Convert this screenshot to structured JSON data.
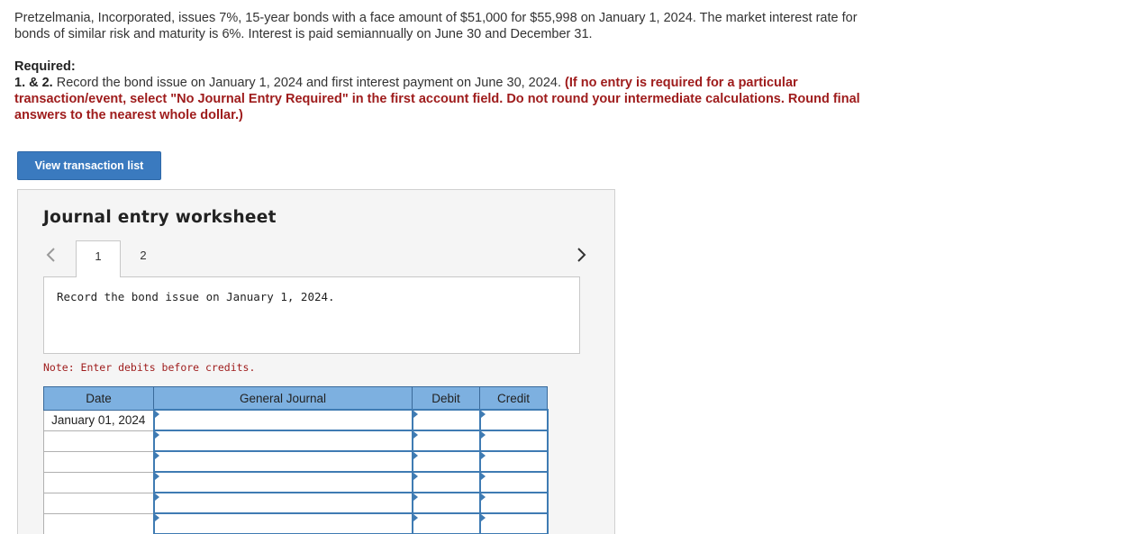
{
  "problem": {
    "text": "Pretzelmania, Incorporated, issues 7%, 15-year bonds with a face amount of $51,000 for $55,998 on January 1, 2024. The market interest rate for bonds of similar risk and maturity is 6%. Interest is paid semiannually on June 30 and December 31."
  },
  "required": {
    "title": "Required:",
    "number": "1. & 2.",
    "task": " Record the bond issue on January 1, 2024 and first interest payment on June 30, 2024. ",
    "instructions": "(If no entry is required for a particular transaction/event, select \"No Journal Entry Required\" in the first account field. Do not round your intermediate calculations. Round final answers to the nearest whole dollar.)"
  },
  "buttons": {
    "view_transactions": "View transaction list"
  },
  "worksheet": {
    "title": "Journal entry worksheet",
    "tabs": [
      "1",
      "2"
    ],
    "active_tab": "1",
    "instruction": "Record the bond issue on January 1, 2024.",
    "note": "Note: Enter debits before credits."
  },
  "journal": {
    "headers": {
      "date": "Date",
      "general_journal": "General Journal",
      "debit": "Debit",
      "credit": "Credit"
    },
    "rows": [
      {
        "date": "January 01, 2024",
        "account": "",
        "debit": "",
        "credit": ""
      },
      {
        "date": "",
        "account": "",
        "debit": "",
        "credit": ""
      },
      {
        "date": "",
        "account": "",
        "debit": "",
        "credit": ""
      },
      {
        "date": "",
        "account": "",
        "debit": "",
        "credit": ""
      },
      {
        "date": "",
        "account": "",
        "debit": "",
        "credit": ""
      },
      {
        "date": "",
        "account": "",
        "debit": "",
        "credit": ""
      }
    ]
  },
  "colors": {
    "button_blue": "#3a7abf",
    "header_blue": "#7db0e0",
    "instruction_red": "#9e1b1b",
    "cell_border_blue": "#3f7bb3"
  },
  "icons": {
    "prev": "chevron-left-icon",
    "next": "chevron-right-icon"
  }
}
